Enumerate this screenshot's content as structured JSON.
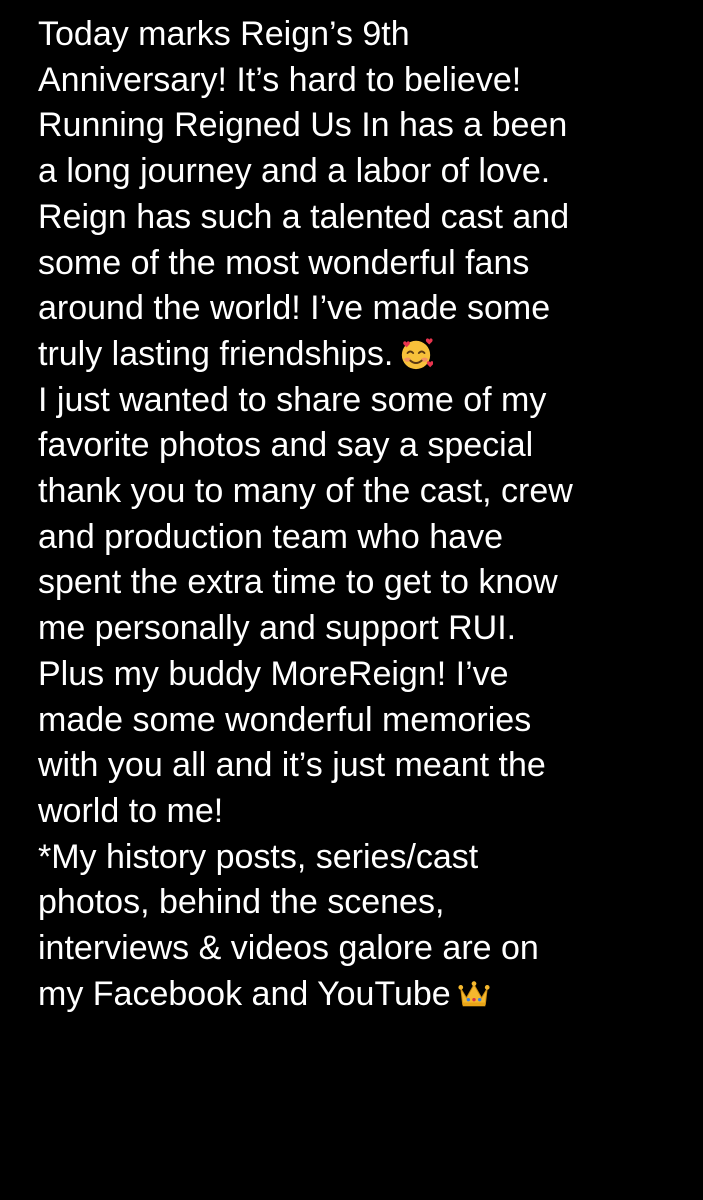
{
  "note": {
    "lines": [
      "Today marks Reign’s 9th",
      "Anniversary! It’s hard to believe!",
      "Running Reigned Us In has a been",
      "a long journey and a labor of love.",
      "Reign has such a talented cast and",
      "some of the most wonderful fans",
      "around the world! I’ve made some",
      "truly lasting friendships.",
      "I just wanted to share some of my",
      "favorite photos and say a special",
      "thank you to many of the cast, crew",
      "and production team who have",
      "spent the extra time to get to know",
      "me personally and support RUI.",
      "Plus my buddy MoreReign! I’ve",
      "made some wonderful memories",
      "with you all and it’s just meant the",
      "world to me!",
      "*My history posts, series/cast",
      "photos, behind the scenes,",
      "interviews & videos galore are on",
      "my Facebook and YouTube"
    ],
    "emojis": {
      "smiling_hearts": "smiling-face-with-hearts-icon",
      "crown": "crown-icon"
    }
  }
}
